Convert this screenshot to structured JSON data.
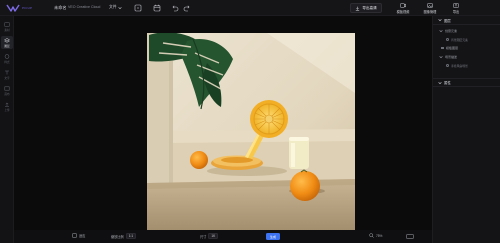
{
  "header": {
    "brand_sub": "PICUP",
    "app_name": "未命名",
    "app_sub": "VEO Creative Cloud",
    "file_menu": "文件",
    "export_label": "导出高清",
    "right_items": [
      {
        "label": "模板视频",
        "icon": "video-icon"
      },
      {
        "label": "图像管理",
        "icon": "image-manage-icon"
      },
      {
        "label": "导出",
        "icon": "export-icon"
      }
    ]
  },
  "sidebar": {
    "items": [
      {
        "label": "素材",
        "icon": "assets-icon",
        "active": false
      },
      {
        "label": "图层",
        "icon": "layers-icon",
        "active": true
      },
      {
        "label": "样式",
        "icon": "style-icon",
        "active": false
      },
      {
        "label": "文字",
        "icon": "text-icon",
        "active": false
      },
      {
        "label": "画布",
        "icon": "canvas-icon",
        "active": false
      },
      {
        "label": "上传",
        "icon": "upload-icon",
        "active": false
      }
    ]
  },
  "canvas": {
    "watermark": "— — — — — — — — — — —"
  },
  "bottombar": {
    "fit_label": "适应",
    "ratio_label": "缩放比例",
    "ratio_value": "1:1",
    "size_label": "尺寸",
    "size_value": "1K",
    "generate_label": "生成",
    "zoom_value": "75%"
  },
  "right_panel": {
    "section1": "图层",
    "layer1": "创意元素",
    "layer1_sub": "背景图层元素",
    "layer2": "模板图层",
    "layer3": "场景描述",
    "layer3_sub": "手持风扇场景",
    "section2": "属性"
  },
  "colors": {
    "accent": "#3d72f0",
    "brand": "#6b5bd6",
    "panel_bg": "#141417",
    "canvas_bg": "#0b0b0c"
  }
}
